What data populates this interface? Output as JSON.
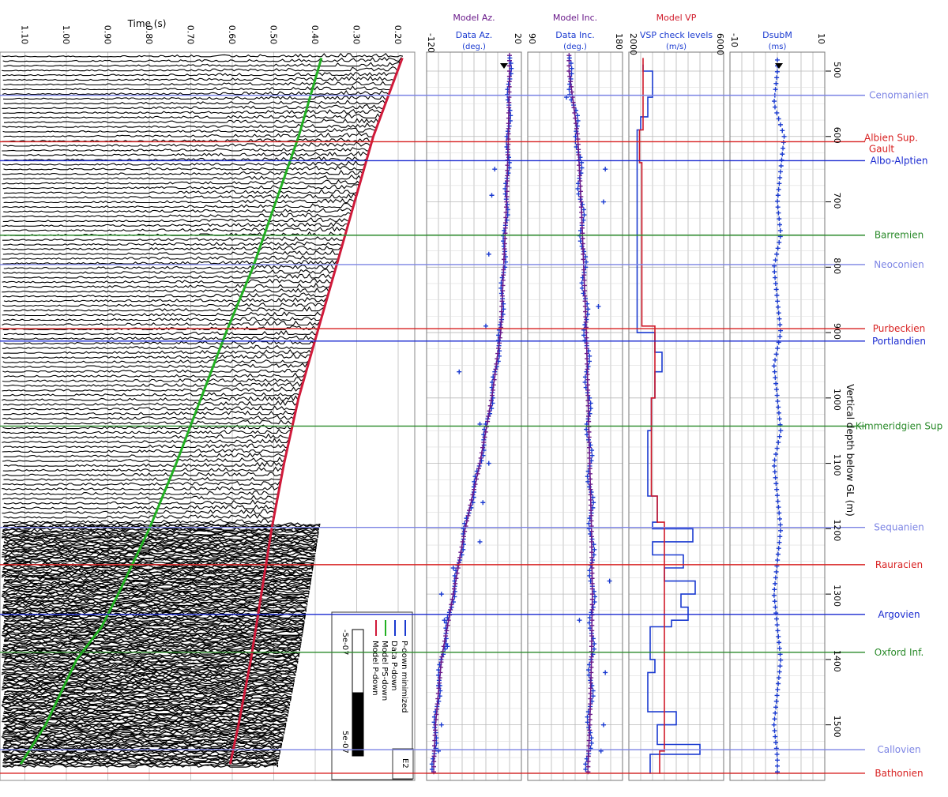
{
  "chart_data": [
    {
      "type": "line",
      "panel": "seismic",
      "xlabel": "Time (s)",
      "x_ticks": [
        "1.10",
        "1.00",
        "0.90",
        "0.80",
        "0.70",
        "0.60",
        "0.50",
        "0.40",
        "0.30",
        "0.20"
      ],
      "x_tick_values": [
        1.1,
        1.0,
        0.9,
        0.8,
        0.7,
        0.6,
        0.5,
        0.4,
        0.3,
        0.2
      ],
      "xlim": [
        1.16,
        0.16
      ],
      "x_reversed": true,
      "label_tag": "E2",
      "legend": {
        "items": [
          {
            "label": "P-down minimized",
            "color": "#1a3ad0"
          },
          {
            "label": "Data P-down",
            "color": "#1a3ad0"
          },
          {
            "label": "Model PS-down",
            "color": "#22b022"
          },
          {
            "label": "Model P-down",
            "color": "#d01a3a"
          }
        ],
        "scale_min": "-5e-07",
        "scale_max": "5e-07"
      },
      "series": [
        {
          "name": "Model PS-down",
          "color": "#22b022",
          "depths": [
            480,
            600,
            700,
            800,
            900,
            1000,
            1100,
            1200,
            1300,
            1350,
            1400,
            1500,
            1560
          ],
          "times": [
            0.385,
            0.44,
            0.495,
            0.55,
            0.615,
            0.675,
            0.735,
            0.8,
            0.875,
            0.915,
            0.975,
            1.05,
            1.11
          ]
        },
        {
          "name": "Model P-down",
          "color": "#d01a3a",
          "depths": [
            480,
            600,
            700,
            800,
            900,
            1000,
            1100,
            1200,
            1300,
            1400,
            1500,
            1560
          ],
          "times": [
            0.19,
            0.26,
            0.305,
            0.35,
            0.395,
            0.44,
            0.475,
            0.505,
            0.53,
            0.555,
            0.585,
            0.605
          ]
        }
      ]
    },
    {
      "type": "scatter",
      "panel": "azimuth",
      "title_top": "Model Az.",
      "title_sub": "Data Az.",
      "unit": "(deg.)",
      "x_ticks": [
        "-120",
        "20"
      ],
      "x_tick_values": [
        -120,
        20
      ],
      "xlim": [
        -120,
        40
      ],
      "model_depths": [
        500,
        600,
        700,
        800,
        900,
        1000,
        1100,
        1200,
        1300,
        1400,
        1500,
        1560
      ],
      "model_values": [
        20,
        18,
        15,
        10,
        5,
        -10,
        -30,
        -55,
        -75,
        -95,
        -105,
        -108
      ],
      "data_depths": [
        650,
        690,
        780,
        890,
        960,
        1040,
        1100,
        1160,
        1220,
        1260,
        1300,
        1340,
        1380,
        1440,
        1500,
        1540
      ],
      "data_values": [
        -5,
        -10,
        -15,
        -20,
        -65,
        -30,
        -15,
        -25,
        -30,
        -75,
        -95,
        -90,
        -85,
        -100,
        -95,
        -100
      ]
    },
    {
      "type": "scatter",
      "panel": "inclination",
      "title_top": "Model Inc.",
      "title_sub": "Data Inc.",
      "unit": "(deg.)",
      "x_ticks": [
        "90",
        "180"
      ],
      "x_tick_values": [
        90,
        180
      ],
      "xlim": [
        90,
        200
      ],
      "model_depths": [
        500,
        600,
        700,
        800,
        900,
        1000,
        1100,
        1200,
        1300,
        1400,
        1500,
        1560
      ],
      "model_values": [
        138,
        148,
        152,
        155,
        158,
        160,
        162,
        164,
        165,
        164,
        162,
        160
      ],
      "data_depths": [
        540,
        650,
        700,
        860,
        1280,
        1340,
        1420,
        1500,
        1540
      ],
      "data_values": [
        135,
        180,
        178,
        172,
        185,
        150,
        180,
        178,
        175
      ]
    },
    {
      "type": "line",
      "panel": "velocity",
      "title_top": "Model VP",
      "title_sub": "VSP check levels",
      "unit": "(m/s)",
      "x_ticks": [
        "2000",
        "6000"
      ],
      "x_tick_values": [
        2000,
        6000
      ],
      "xlim": [
        2000,
        6000
      ],
      "model_steps": [
        {
          "top": 480,
          "vp": 2600
        },
        {
          "top": 590,
          "vp": 2450
        },
        {
          "top": 640,
          "vp": 2550
        },
        {
          "top": 890,
          "vp": 3100
        },
        {
          "top": 1000,
          "vp": 2950
        },
        {
          "top": 1150,
          "vp": 3200
        },
        {
          "top": 1190,
          "vp": 3500
        },
        {
          "top": 1540,
          "vp": 3300
        }
      ],
      "data_steps": [
        {
          "top": 490,
          "vp": 2600
        },
        {
          "top": 500,
          "vp": 3000
        },
        {
          "top": 540,
          "vp": 2800
        },
        {
          "top": 570,
          "vp": 2500
        },
        {
          "top": 590,
          "vp": 2350
        },
        {
          "top": 900,
          "vp": 3100
        },
        {
          "top": 930,
          "vp": 3400
        },
        {
          "top": 960,
          "vp": 3100
        },
        {
          "top": 1000,
          "vp": 2950
        },
        {
          "top": 1050,
          "vp": 2800
        },
        {
          "top": 1150,
          "vp": 3200
        },
        {
          "top": 1190,
          "vp": 3000
        },
        {
          "top": 1200,
          "vp": 4700
        },
        {
          "top": 1220,
          "vp": 3000
        },
        {
          "top": 1240,
          "vp": 4300
        },
        {
          "top": 1260,
          "vp": 3500
        },
        {
          "top": 1280,
          "vp": 4800
        },
        {
          "top": 1300,
          "vp": 4200
        },
        {
          "top": 1320,
          "vp": 4500
        },
        {
          "top": 1340,
          "vp": 3800
        },
        {
          "top": 1350,
          "vp": 2900
        },
        {
          "top": 1400,
          "vp": 3100
        },
        {
          "top": 1420,
          "vp": 2800
        },
        {
          "top": 1480,
          "vp": 4000
        },
        {
          "top": 1500,
          "vp": 3200
        },
        {
          "top": 1530,
          "vp": 5000
        },
        {
          "top": 1545,
          "vp": 2900
        },
        {
          "top": 1560,
          "vp": 2900
        }
      ]
    },
    {
      "type": "scatter",
      "panel": "dsubm",
      "title_sub": "DsubM",
      "unit": "(ms)",
      "x_ticks": [
        "-10",
        "10"
      ],
      "x_tick_values": [
        -10,
        10
      ],
      "xlim": [
        -14,
        14
      ],
      "depths": [
        500,
        550,
        600,
        650,
        700,
        750,
        800,
        850,
        900,
        950,
        1000,
        1050,
        1100,
        1150,
        1200,
        1250,
        1300,
        1350,
        1400,
        1450,
        1500,
        1550
      ],
      "values": [
        0,
        -1,
        2,
        1,
        0,
        1,
        -1,
        0,
        1,
        -1,
        0,
        1,
        -1,
        0,
        1,
        0,
        -1,
        0,
        1,
        0,
        -1,
        0
      ]
    }
  ],
  "depth_axis": {
    "label": "Vertical depth below GL (m)",
    "ticks": [
      "500",
      "600",
      "700",
      "800",
      "900",
      "1000",
      "1100",
      "1200",
      "1300",
      "1400",
      "1500"
    ],
    "tick_values": [
      500,
      600,
      700,
      800,
      900,
      1000,
      1100,
      1200,
      1300,
      1400,
      1500
    ],
    "range": [
      471,
      1585
    ]
  },
  "horizons": [
    {
      "name": "Cenomanien",
      "depth": 537,
      "color": "#7c84e4"
    },
    {
      "name": "Albien Sup. Gault",
      "depth": 608,
      "color": "#d82020"
    },
    {
      "name": "Albo-Alptien",
      "depth": 637,
      "color": "#1a2ad0"
    },
    {
      "name": "Barremien",
      "depth": 751,
      "color": "#2a8a2a"
    },
    {
      "name": "Neoconien",
      "depth": 796,
      "color": "#7c84e4"
    },
    {
      "name": "Purbeckien",
      "depth": 894,
      "color": "#d82020"
    },
    {
      "name": "Portlandien",
      "depth": 913,
      "color": "#1a2ad0"
    },
    {
      "name": "Kimmeridgien Sup",
      "depth": 1043,
      "color": "#2a8a2a"
    },
    {
      "name": "Sequanien",
      "depth": 1198,
      "color": "#7c84e4"
    },
    {
      "name": "Rauracien",
      "depth": 1255,
      "color": "#d82020"
    },
    {
      "name": "Argovien",
      "depth": 1331,
      "color": "#1a2ad0"
    },
    {
      "name": "Oxford Inf.",
      "depth": 1389,
      "color": "#2a8a2a"
    },
    {
      "name": "Callovien",
      "depth": 1538,
      "color": "#7c84e4"
    },
    {
      "name": "Bathonien",
      "depth": 1574,
      "color": "#d82020"
    }
  ],
  "colors": {
    "purple": "#6a1a8a",
    "data_blue": "#1a3ad0",
    "model_red": "#d01a2a",
    "grid": "#b8b8b8",
    "trace": "#000000"
  }
}
